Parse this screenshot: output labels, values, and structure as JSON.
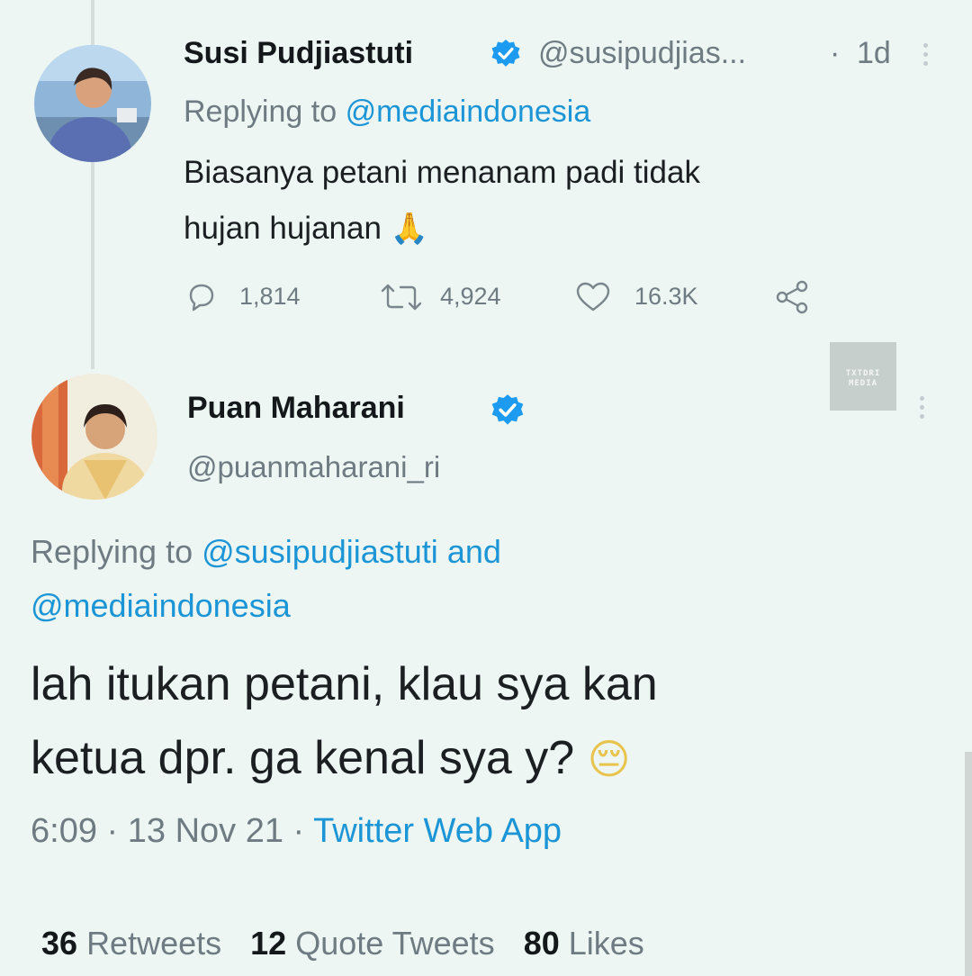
{
  "tweet1": {
    "author_name": "Susi Pudjiastuti",
    "handle": "@susipudjias...",
    "time_sep": "·",
    "time": "1d",
    "replying_prefix": "Replying to",
    "replying_handle": "@mediaindonesia",
    "text_line1": "Biasanya petani menanam padi tidak",
    "text_line2": "hujan hujanan",
    "emoji": "🙏",
    "replies": "1,814",
    "retweets": "4,924",
    "likes": "16.3K"
  },
  "tweet2": {
    "author_name": "Puan Maharani",
    "handle": "@puanmaharani_ri",
    "replying_prefix": "Replying to",
    "replying_handle1": "@susipudjiastuti",
    "replying_and": "and",
    "replying_handle2": "@mediaindonesia",
    "text_line1": "lah itukan petani, klau sya kan",
    "text_line2": "ketua dpr. ga kenal sya y?",
    "emoji": "😔",
    "time": "6:09",
    "sep1": "·",
    "date": "13 Nov 21",
    "sep2": "·",
    "source": "Twitter Web App",
    "retweets_count": "36",
    "retweets_label": "Retweets",
    "quotes_count": "12",
    "quotes_label": "Quote Tweets",
    "likes_count": "80",
    "likes_label": "Likes"
  },
  "watermark": {
    "line1": "TXTDRI",
    "line2": "MEDIA"
  },
  "icons": {
    "verified": "verified-badge-icon",
    "reply": "reply-icon",
    "retweet": "retweet-icon",
    "like": "heart-icon",
    "share": "share-icon",
    "more": "more-icon"
  },
  "colors": {
    "background": "#edf6f2",
    "link": "#1b95d6",
    "muted": "#6f7b82",
    "verified": "#1d9bf0"
  }
}
